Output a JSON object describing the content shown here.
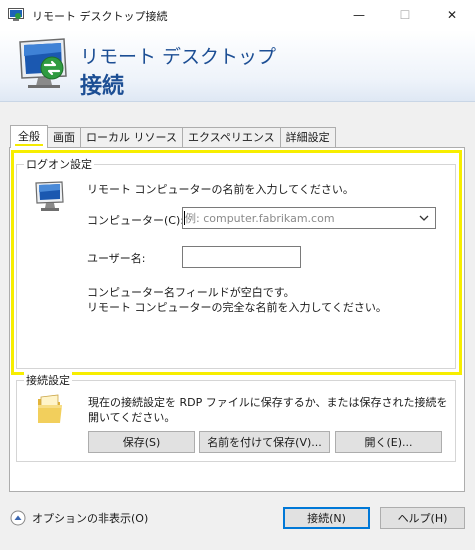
{
  "window": {
    "title": "リモート デスクトップ接続",
    "minimize_glyph": "—",
    "maximize_glyph": "☐",
    "close_glyph": "✕"
  },
  "banner": {
    "line1": "リモート デスクトップ",
    "line2": "接続",
    "icon": "remote-desktop-logo"
  },
  "tabs": [
    {
      "label": "全般",
      "active": true
    },
    {
      "label": "画面",
      "active": false
    },
    {
      "label": "ローカル リソース",
      "active": false
    },
    {
      "label": "エクスペリエンス",
      "active": false
    },
    {
      "label": "詳細設定",
      "active": false
    }
  ],
  "logon": {
    "legend": "ログオン設定",
    "instruction": "リモート コンピューターの名前を入力してください。",
    "computer_label": "コンピューター(C):",
    "computer_placeholder": "例: computer.fabrikam.com",
    "computer_value": "",
    "username_label": "ユーザー名:",
    "username_value": "",
    "hint_line1": "コンピューター名フィールドが空白です。",
    "hint_line2": "リモート コンピューターの完全な名前を入力してください。",
    "icon": "computer-icon"
  },
  "connection": {
    "legend": "接続設定",
    "description_line1": "現在の接続設定を RDP ファイルに保存するか、または保存された接続を",
    "description_line2": "開いてください。",
    "save_label": "保存(S)",
    "save_as_label": "名前を付けて保存(V)...",
    "open_label": "開く(E)...",
    "icon": "folder-icon"
  },
  "footer": {
    "options_label": "オプションの非表示(O)",
    "connect_label": "接続(N)",
    "help_label": "ヘルプ(H)"
  },
  "colors": {
    "highlight": "#f7ee00",
    "banner_text": "#1c4e94",
    "primary_border": "#0078d7"
  }
}
